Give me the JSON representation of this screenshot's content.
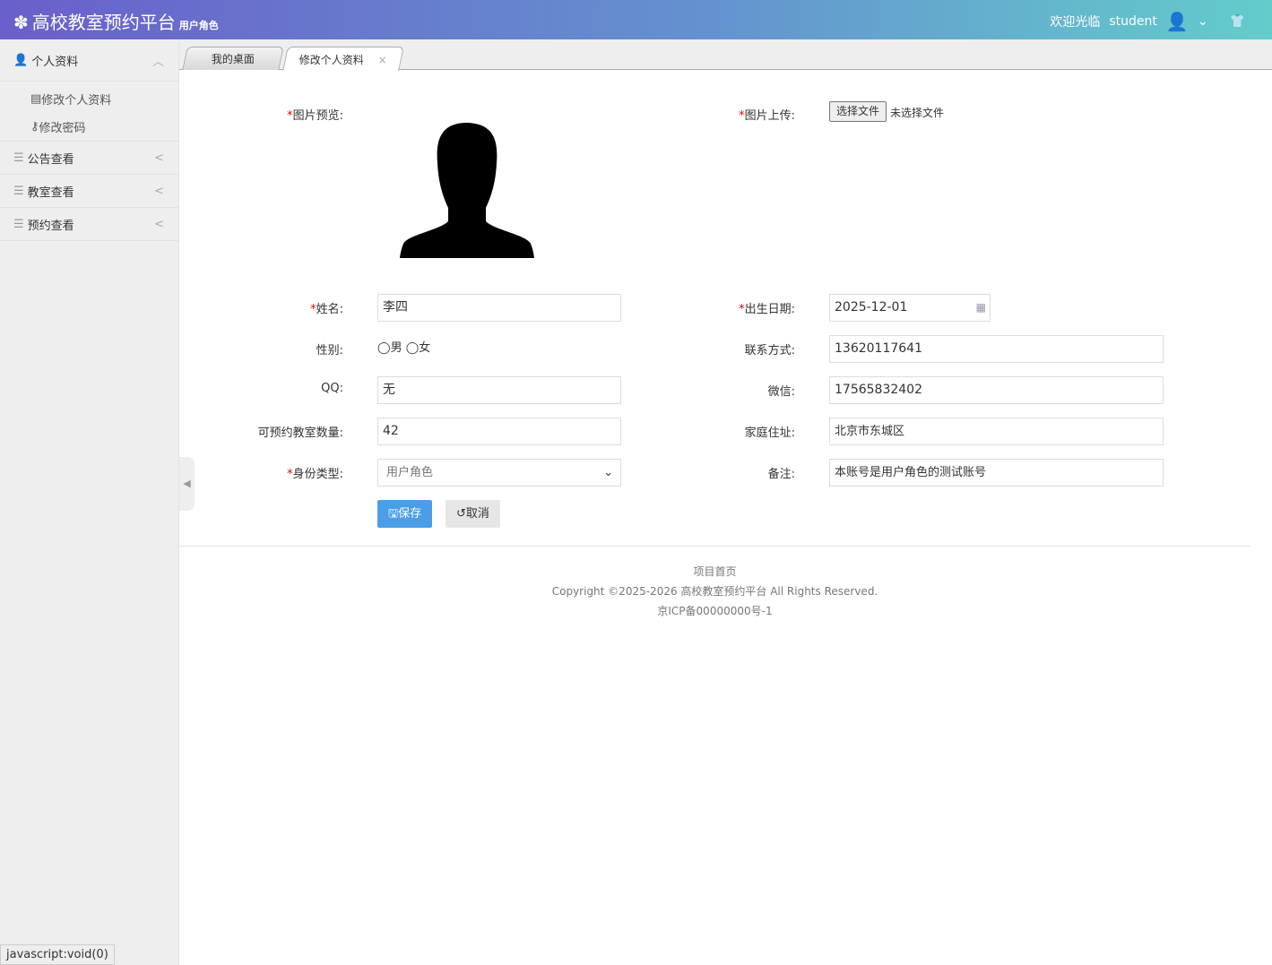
{
  "header": {
    "title": "高校教室预约平台",
    "role": "用户角色",
    "welcome": "欢迎光临",
    "user": "student"
  },
  "sidebar": {
    "groups": [
      {
        "label": "个人资料",
        "items": [
          "修改个人资料",
          "修改密码"
        ]
      },
      {
        "label": "公告查看"
      },
      {
        "label": "教室查看"
      },
      {
        "label": "预约查看"
      }
    ]
  },
  "tabs": [
    "我的桌面",
    "修改个人资料"
  ],
  "form": {
    "photo_label": "图片预览:",
    "upload_label": "图片上传:",
    "choose_file": "选择文件",
    "no_file": "未选择文件",
    "name_label": "姓名:",
    "name": "李四",
    "birth_label": "出生日期:",
    "birth": "2025-12-01",
    "gender_label": "性别:",
    "male": "男",
    "female": "女",
    "phone_label": "联系方式:",
    "phone": "13620117641",
    "qq_label": "QQ:",
    "qq": "无",
    "wechat_label": "微信:",
    "wechat": "17565832402",
    "count_label": "可预约教室数量:",
    "count": "42",
    "address_label": "家庭住址:",
    "address": "北京市东城区",
    "type_label": "身份类型:",
    "type": "用户角色",
    "note_label": "备注:",
    "note": "本账号是用户角色的测试账号",
    "save": "保存",
    "cancel": "取消"
  },
  "footer": {
    "home": "项目首页",
    "copyright": "Copyright ©2025-2026 高校教室预约平台 All Rights Reserved.",
    "icp": "京ICP备00000000号-1"
  },
  "status": "javascript:void(0)"
}
